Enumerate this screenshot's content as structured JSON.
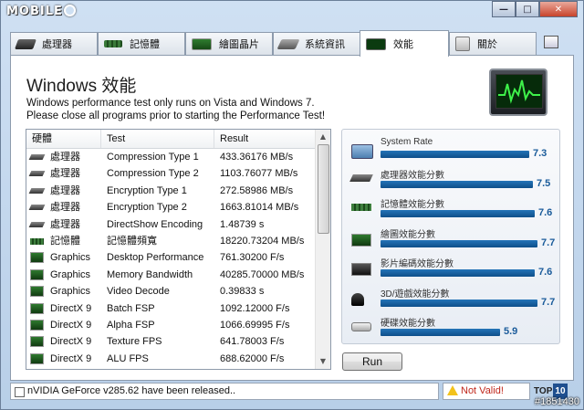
{
  "logo": {
    "text": "MOBILE",
    "suffix": "01"
  },
  "window_buttons": {
    "minimize": "—",
    "maximize": "□",
    "close": "✕"
  },
  "tabs": [
    {
      "label": "處理器",
      "icon": "cpu-icon"
    },
    {
      "label": "記憶體",
      "icon": "memory-icon"
    },
    {
      "label": "繪圖晶片",
      "icon": "graphics-card-icon"
    },
    {
      "label": "系統資訊",
      "icon": "system-icon"
    },
    {
      "label": "效能",
      "icon": "performance-icon",
      "active": true
    },
    {
      "label": "關於",
      "icon": "about-icon"
    }
  ],
  "main": {
    "title": "Windows 效能",
    "note_line1": "Windows performance test only runs on Vista and Windows 7.",
    "note_line2": "Please close all programs prior to starting the Performance Test!"
  },
  "table": {
    "headers": {
      "hardware": "硬體",
      "test": "Test",
      "result": "Result"
    },
    "rows": [
      {
        "hw": "處理器",
        "icon": "cpu",
        "test": "Compression Type 1",
        "result": "433.36176 MB/s"
      },
      {
        "hw": "處理器",
        "icon": "cpu",
        "test": "Compression Type 2",
        "result": "1103.76077 MB/s"
      },
      {
        "hw": "處理器",
        "icon": "cpu",
        "test": "Encryption Type 1",
        "result": "272.58986 MB/s"
      },
      {
        "hw": "處理器",
        "icon": "cpu",
        "test": "Encryption Type 2",
        "result": "1663.81014 MB/s"
      },
      {
        "hw": "處理器",
        "icon": "cpu",
        "test": "DirectShow Encoding",
        "result": "1.48739 s"
      },
      {
        "hw": "記憶體",
        "icon": "mem",
        "test": "記憶體頻寬",
        "result": "18220.73204 MB/s"
      },
      {
        "hw": "Graphics",
        "icon": "gfx",
        "test": "Desktop Performance",
        "result": "761.30200 F/s"
      },
      {
        "hw": "Graphics",
        "icon": "gfx",
        "test": "Memory Bandwidth",
        "result": "40285.70000 MB/s"
      },
      {
        "hw": "Graphics",
        "icon": "gfx",
        "test": "Video Decode",
        "result": "0.39833 s"
      },
      {
        "hw": "DirectX 9",
        "icon": "gfx",
        "test": "Batch FSP",
        "result": "1092.12000 F/s"
      },
      {
        "hw": "DirectX 9",
        "icon": "gfx",
        "test": "Alpha FSP",
        "result": "1066.69995 F/s"
      },
      {
        "hw": "DirectX 9",
        "icon": "gfx",
        "test": "Texture FPS",
        "result": "641.78003 F/s"
      },
      {
        "hw": "DirectX 9",
        "icon": "gfx",
        "test": "ALU FPS",
        "result": "688.62000 F/s"
      }
    ]
  },
  "ratings": [
    {
      "label": "System Rate",
      "value": "7.3",
      "score": 7.3,
      "icon": "system-rate-icon",
      "cls": "ri-sys"
    },
    {
      "label": "處理器效能分數",
      "value": "7.5",
      "score": 7.5,
      "icon": "cpu-score-icon",
      "cls": "ri-cpu"
    },
    {
      "label": "記憶體效能分數",
      "value": "7.6",
      "score": 7.6,
      "icon": "memory-score-icon",
      "cls": "ri-mem"
    },
    {
      "label": "繪圖效能分數",
      "value": "7.7",
      "score": 7.7,
      "icon": "graphics-score-icon",
      "cls": "ri-gpu"
    },
    {
      "label": "影片編碼效能分數",
      "value": "7.6",
      "score": 7.6,
      "icon": "video-score-icon",
      "cls": "ri-vid"
    },
    {
      "label": "3D/遊戲效能分數",
      "value": "7.7",
      "score": 7.7,
      "icon": "gaming-score-icon",
      "cls": "ri-3d"
    },
    {
      "label": "硬碟效能分數",
      "value": "5.9",
      "score": 5.9,
      "icon": "disk-score-icon",
      "cls": "ri-hdd"
    }
  ],
  "run_button": "Run",
  "status": {
    "message": "nVIDIA GeForce v285.62 have been released..",
    "validity": "Not Valid!",
    "brand": "TOP",
    "brand_num": "10"
  },
  "watermark": "#1851430"
}
